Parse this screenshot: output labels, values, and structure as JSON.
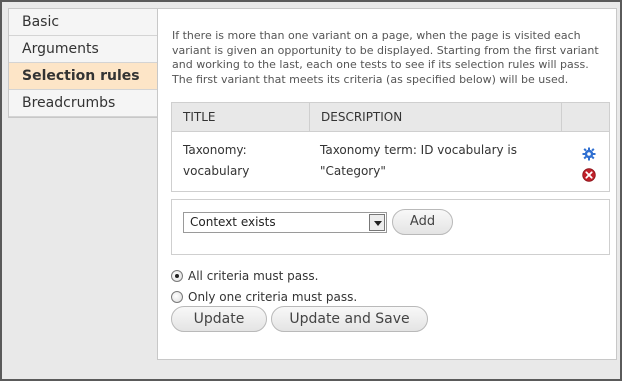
{
  "tabs": [
    {
      "label": "Basic"
    },
    {
      "label": "Arguments"
    },
    {
      "label": "Selection rules",
      "active": true
    },
    {
      "label": "Breadcrumbs"
    }
  ],
  "description": "If there is more than one variant on a page, when the page is visited each variant is given an opportunity to be displayed. Starting from the first variant and working to the last, each one tests to see if its selection rules will pass. The first variant that meets its criteria (as specified below) will be used.",
  "table": {
    "headers": {
      "title": "TITLE",
      "description": "DESCRIPTION"
    },
    "rows": [
      {
        "title": "Taxonomy: vocabulary",
        "description": "Taxonomy term: ID vocabulary is \"Category\""
      }
    ]
  },
  "add_rule": {
    "select_value": "Context exists",
    "add_label": "Add"
  },
  "criteria": {
    "options": [
      {
        "label": "All criteria must pass.",
        "checked": true
      },
      {
        "label": "Only one criteria must pass.",
        "checked": false
      }
    ]
  },
  "actions": {
    "update_label": "Update",
    "update_save_label": "Update and Save"
  },
  "colors": {
    "active_tab_bg": "#fde5c7",
    "remove_icon": "#c0202a",
    "settings_icon": "#2f6fd1"
  },
  "icons": {
    "settings": "gear-icon",
    "remove": "remove-icon"
  }
}
